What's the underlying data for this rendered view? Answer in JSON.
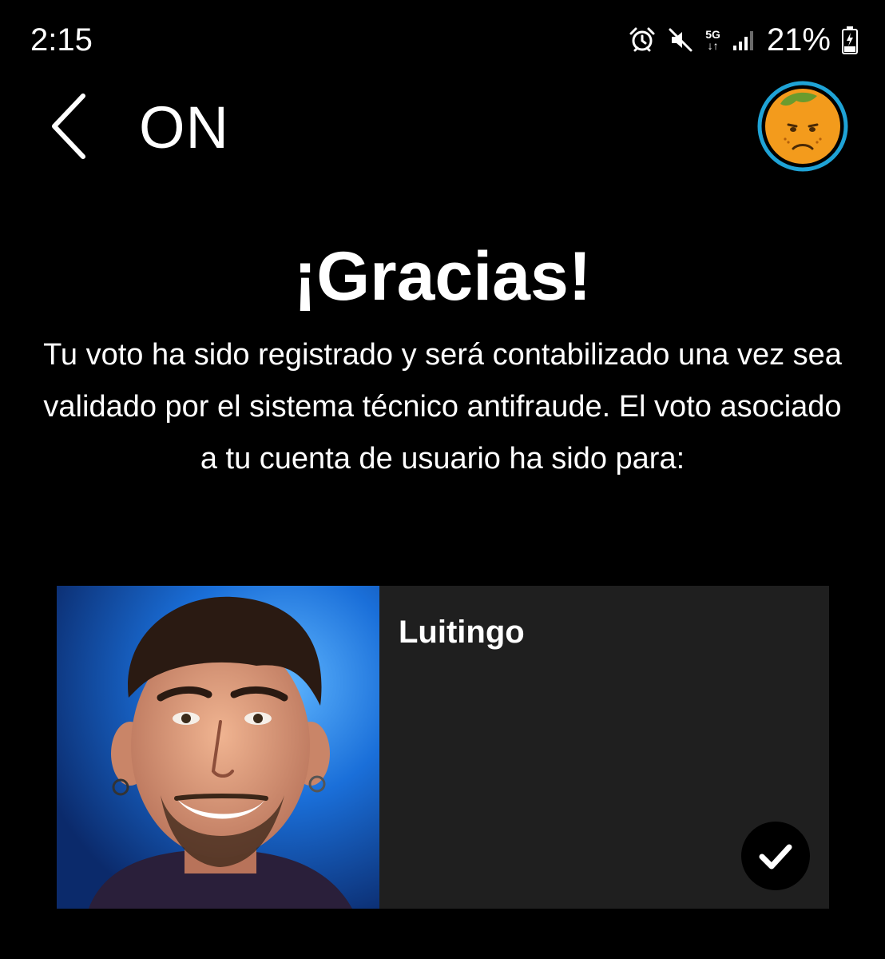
{
  "status_bar": {
    "time": "2:15",
    "network_top": "5G",
    "network_bottom": "↓↑",
    "battery": "21%",
    "icons": [
      "alarm-icon",
      "mute-icon",
      "network-5g-icon",
      "signal-icon",
      "battery-charging-icon"
    ]
  },
  "header": {
    "title": "ON",
    "back_icon": "chevron-left-icon",
    "avatar_icon": "orange-face-avatar"
  },
  "content": {
    "title": "¡Gracias!",
    "message": "Tu voto ha sido registrado y será contabilizado una vez sea validado por el sistema técnico antifraude. El voto asociado a tu cuenta de usuario ha sido para:"
  },
  "candidate": {
    "name": "Luitingo",
    "selected": true,
    "check_icon": "checkmark-icon"
  },
  "colors": {
    "background": "#000000",
    "card": "#1f1f1f",
    "text": "#ffffff",
    "avatar_ring": "#1fa3d6",
    "avatar_face": "#f39b1c",
    "photo_background": "#1a5fc9"
  }
}
